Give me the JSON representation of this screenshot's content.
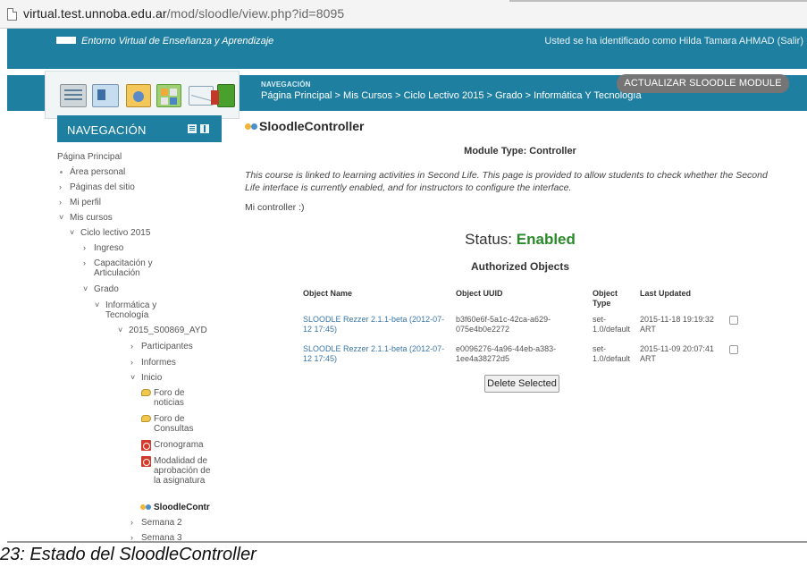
{
  "browser": {
    "url_host": "virtual.test.unnoba.edu.ar",
    "url_path": "/mod/sloodle/view.php?id=8095"
  },
  "site": {
    "brand": "Entorno Virtual de Enseñanza y Aprendizaje",
    "user_info": "Usted se ha identificado como Hilda Tamara AHMAD (Salir)"
  },
  "header": {
    "icons": [
      "notes-icon",
      "id-card-icon",
      "folder-photo-icon",
      "calendar-grid-icon",
      "mail-icon",
      "books-icon"
    ],
    "navigation_label": "NAVEGACIÓN",
    "breadcrumb": "Página Principal > Mis Cursos > Ciclo Lectivo 2015 > Grado > Informática Y Tecnología",
    "update_button": "ACTUALIZAR SLOODLE MODULE"
  },
  "sidebar": {
    "title": "NAVEGACIÓN",
    "items": [
      {
        "label": "Página Principal",
        "mark": ""
      },
      {
        "label": "Área personal",
        "mark": "dot"
      },
      {
        "label": "Páginas del sitio",
        "mark": "›"
      },
      {
        "label": "Mi perfil",
        "mark": "›"
      },
      {
        "label": "Mis cursos",
        "mark": "˅"
      },
      {
        "label": "Ciclo lectivo 2015",
        "mark": "˅"
      },
      {
        "label": "Ingreso",
        "mark": "›"
      },
      {
        "label": "Capacitación y Articulación",
        "mark": "›"
      },
      {
        "label": "Grado",
        "mark": "˅"
      },
      {
        "label": "Informática y Tecnología",
        "mark": "˅"
      },
      {
        "label": "2015_S00869_AYD",
        "mark": "˅"
      },
      {
        "label": "Participantes",
        "mark": "›"
      },
      {
        "label": "Informes",
        "mark": "›"
      },
      {
        "label": "Inicio",
        "mark": "˅"
      },
      {
        "label": "Foro de noticias",
        "mark": "forum"
      },
      {
        "label": "Foro de Consultas",
        "mark": "forum"
      },
      {
        "label": "Cronograma",
        "mark": "pdf"
      },
      {
        "label": "Modalidad de aprobación de la asignatura",
        "mark": "pdf"
      },
      {
        "label": "SloodleContr",
        "mark": "sloodle"
      },
      {
        "label": "Semana 2",
        "mark": "›"
      },
      {
        "label": "Semana 3",
        "mark": "›"
      }
    ]
  },
  "main": {
    "title": "SloodleController",
    "module_type": "Module Type: Controller",
    "info": "This course is linked to learning activities in Second Life. This page is provided to allow students to check whether the Second Life interface is currently enabled, and for instructors to configure the interface.",
    "controller_text": "Mi controller :)",
    "status_label": "Status:",
    "status_value": "Enabled",
    "authorized_title": "Authorized Objects",
    "table": {
      "headers": [
        "Object Name",
        "Object UUID",
        "Object Type",
        "Last Updated"
      ],
      "rows": [
        {
          "name": "SLOODLE Rezzer 2.1.1-beta (2012-07-12 17:45)",
          "uuid": "b3f60e6f-5a1c-42ca-a629-075e4b0e2272",
          "type": "set-1.0/default",
          "updated": "2015-11-18 19:19:32 ART"
        },
        {
          "name": "SLOODLE Rezzer 2.1.1-beta (2012-07-12 17:45)",
          "uuid": "e0096276-4a96-44eb-a383-1ee4a38272d5",
          "type": "set-1.0/default",
          "updated": "2015-11-09 20:07:41 ART"
        }
      ]
    },
    "delete_button": "Delete Selected"
  },
  "caption": "23: Estado del SloodleController"
}
